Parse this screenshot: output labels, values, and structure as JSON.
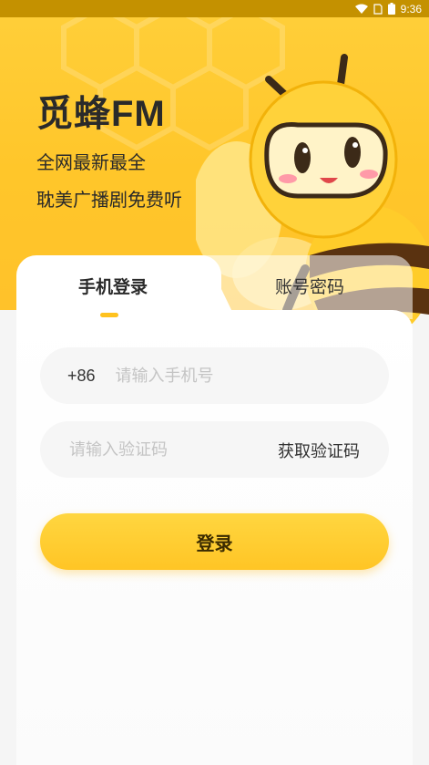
{
  "status_bar": {
    "time": "9:36",
    "icons": [
      "wifi-icon",
      "sim-icon",
      "battery-icon"
    ]
  },
  "hero": {
    "brand": "觅蜂FM",
    "slogan_line1": "全网最新最全",
    "slogan_line2": "耽美广播剧免费听"
  },
  "tabs": [
    {
      "label": "手机登录",
      "active": true
    },
    {
      "label": "账号密码",
      "active": false
    }
  ],
  "phone_field": {
    "prefix": "+86",
    "placeholder": "请输入手机号",
    "value": ""
  },
  "code_field": {
    "placeholder": "请输入验证码",
    "value": "",
    "get_code_label": "获取验证码"
  },
  "login_button": {
    "label": "登录"
  },
  "colors": {
    "accent": "#ffc21e",
    "hero_bg": "#ffcc33",
    "status_bar": "#c49100"
  }
}
